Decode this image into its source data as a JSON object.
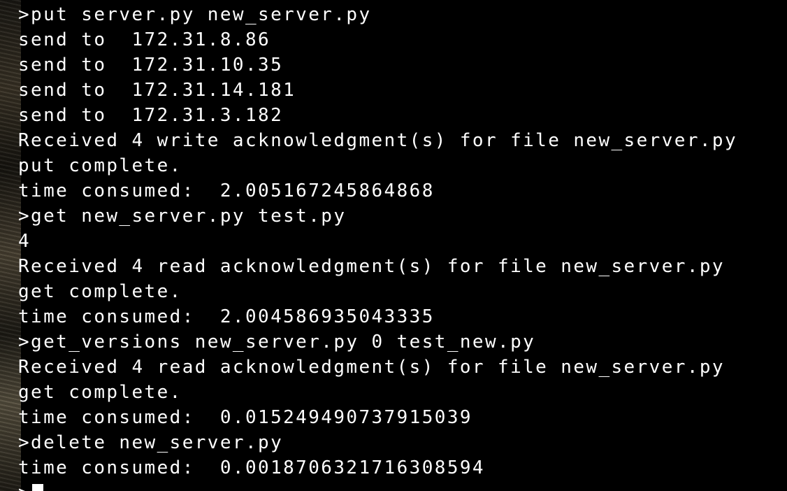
{
  "terminal": {
    "lines": [
      ">put server.py new_server.py",
      "send to  172.31.8.86",
      "send to  172.31.10.35",
      "send to  172.31.14.181",
      "send to  172.31.3.182",
      "Received 4 write acknowledgment(s) for file new_server.py",
      "put complete.",
      "time consumed:  2.005167245864868",
      ">get new_server.py test.py",
      "4",
      "Received 4 read acknowledgment(s) for file new_server.py",
      "get complete.",
      "time consumed:  2.004586935043335",
      ">get_versions new_server.py 0 test_new.py",
      "Received 4 read acknowledgment(s) for file new_server.py",
      "get complete.",
      "time consumed:  0.015249490737915039",
      ">delete new_server.py",
      "time consumed:  0.0018706321716308594"
    ],
    "prompt": ">"
  }
}
